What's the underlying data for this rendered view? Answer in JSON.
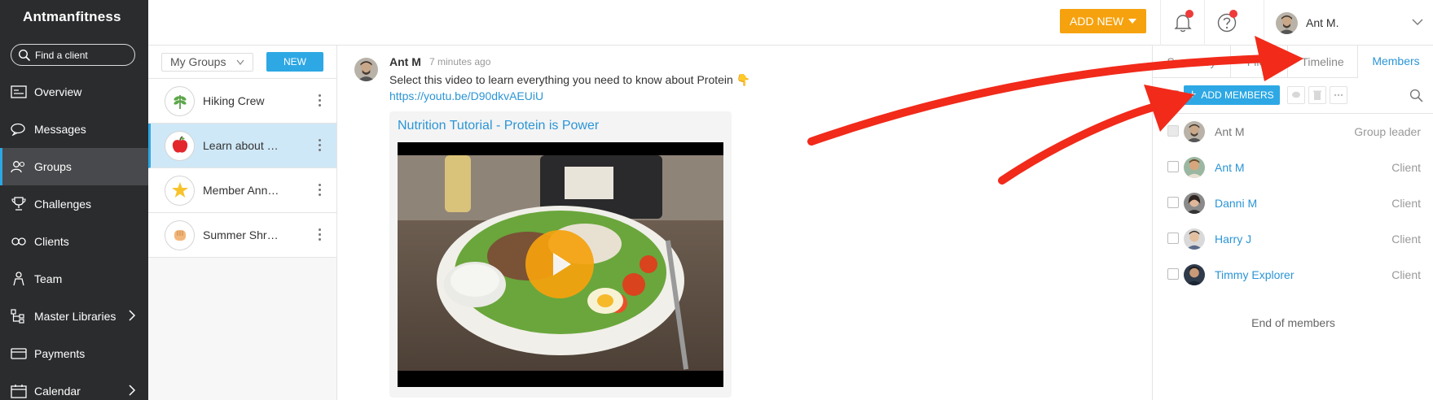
{
  "sidebar": {
    "brand": "Antmanfitness",
    "search_placeholder": "Find a client",
    "items": [
      {
        "label": "Overview",
        "icon": "overview-icon"
      },
      {
        "label": "Messages",
        "icon": "messages-icon"
      },
      {
        "label": "Groups",
        "icon": "groups-icon",
        "active": true
      },
      {
        "label": "Challenges",
        "icon": "trophy-icon"
      },
      {
        "label": "Clients",
        "icon": "clients-icon"
      },
      {
        "label": "Team",
        "icon": "team-icon"
      },
      {
        "label": "Master Libraries",
        "icon": "libraries-icon",
        "has_submenu": true
      },
      {
        "label": "Payments",
        "icon": "payments-icon"
      },
      {
        "label": "Calendar",
        "icon": "calendar-icon",
        "has_submenu": true
      }
    ]
  },
  "topbar": {
    "add_new_label": "ADD NEW",
    "user_name": "Ant M.",
    "notification_dot": true,
    "help_dot": true
  },
  "groups": {
    "filter_label": "My Groups",
    "new_label": "NEW",
    "items": [
      {
        "name": "Hiking Crew",
        "icon": "leaf-icon"
      },
      {
        "name": "Learn about …",
        "icon": "apple-icon",
        "active": true
      },
      {
        "name": "Member Ann…",
        "icon": "star-icon"
      },
      {
        "name": "Summer Shre…",
        "icon": "fist-icon"
      }
    ]
  },
  "post": {
    "author": "Ant M",
    "time": "7 minutes ago",
    "text": "Select this video to learn everything you need to know about Protein 👇",
    "link": "https://youtu.be/D90dkvAEUiU",
    "card_title": "Nutrition Tutorial - Protein is Power"
  },
  "members_panel": {
    "tabs": [
      "Summary",
      "Files",
      "Timeline",
      "Members"
    ],
    "active_tab": "Members",
    "add_members_label": "ADD MEMBERS",
    "members": [
      {
        "name": "Ant M",
        "role": "Group leader"
      },
      {
        "name": "Ant M",
        "role": "Client"
      },
      {
        "name": "Danni M",
        "role": "Client"
      },
      {
        "name": "Harry J",
        "role": "Client"
      },
      {
        "name": "Timmy Explorer",
        "role": "Client"
      }
    ],
    "end_text": "End of members"
  },
  "colors": {
    "sidebar_bg": "#2b2c2e",
    "accent_blue": "#2da8e4",
    "link_blue": "#2b95d6",
    "add_new_orange": "#f6a20e",
    "annotation_red": "#f12a1a"
  }
}
